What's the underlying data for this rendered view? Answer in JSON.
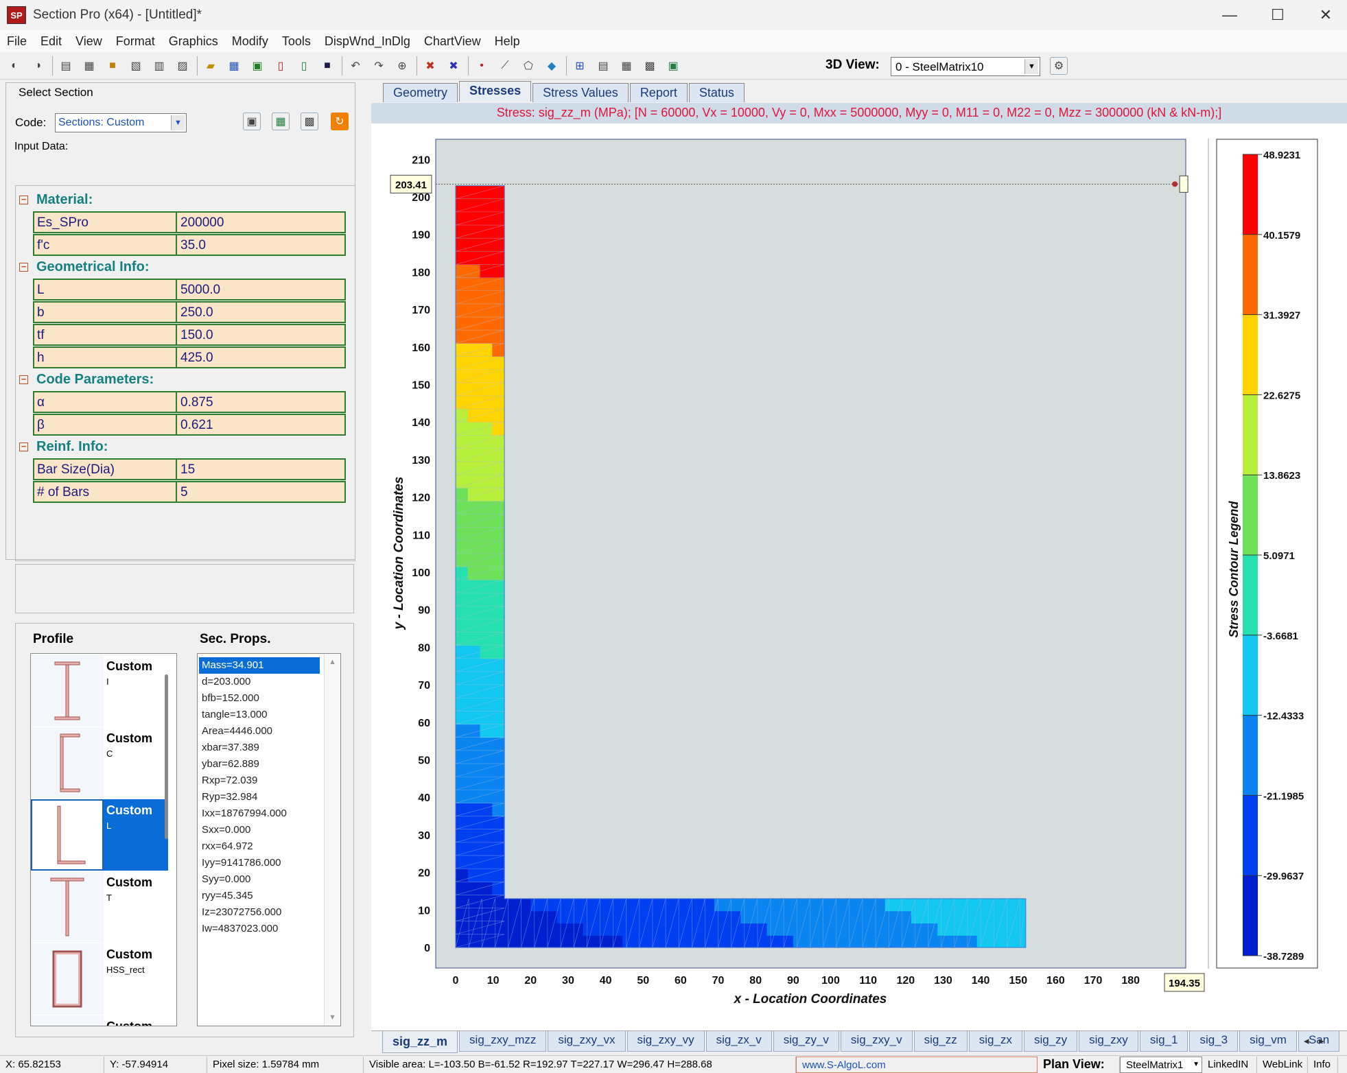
{
  "window": {
    "title": "Section Pro (x64) - [Untitled]*",
    "icon_text": "SP",
    "min_glyph": "—",
    "max_glyph": "☐",
    "close_glyph": "✕"
  },
  "menu": [
    "File",
    "Edit",
    "View",
    "Format",
    "Graphics",
    "Modify",
    "Tools",
    "DispWnd_InDlg",
    "ChartView",
    "Help"
  ],
  "toolbar": {
    "view3d_label": "3D View:",
    "view3d_value": "0 - SteelMatrix10"
  },
  "left": {
    "select_section_label": "Select Section",
    "code_label": "Code:",
    "code_value": "Sections: Custom",
    "input_data_label": "Input Data:",
    "sections": [
      {
        "title": "Material:",
        "rows": [
          {
            "k": "Es_SPro",
            "v": "200000"
          },
          {
            "k": "f'c",
            "v": "35.0"
          }
        ]
      },
      {
        "title": "Geometrical Info:",
        "rows": [
          {
            "k": "L",
            "v": "5000.0"
          },
          {
            "k": "b",
            "v": "250.0"
          },
          {
            "k": "tf",
            "v": "150.0"
          },
          {
            "k": "h",
            "v": "425.0"
          }
        ]
      },
      {
        "title": "Code Parameters:",
        "rows": [
          {
            "k": "α",
            "v": "0.875"
          },
          {
            "k": "β",
            "v": "0.621"
          }
        ]
      },
      {
        "title": "Reinf. Info:",
        "rows": [
          {
            "k": "Bar Size(Dia)",
            "v": "15"
          },
          {
            "k": "# of Bars",
            "v": "5"
          }
        ]
      }
    ],
    "profile_label": "Profile",
    "secprops_label": "Sec. Props.",
    "profiles": [
      {
        "name": "Custom",
        "sub": "I",
        "shape": "I"
      },
      {
        "name": "Custom",
        "sub": "C",
        "shape": "C"
      },
      {
        "name": "Custom",
        "sub": "L",
        "shape": "L",
        "selected": true
      },
      {
        "name": "Custom",
        "sub": "T",
        "shape": "T"
      },
      {
        "name": "Custom",
        "sub": "HSS_rect",
        "shape": "HSS"
      },
      {
        "name": "Custom",
        "sub": "",
        "shape": "pipe"
      }
    ],
    "secprops": [
      "Mass=34.901",
      "d=203.000",
      "bfb=152.000",
      "tangle=13.000",
      "Area=4446.000",
      "xbar=37.389",
      "ybar=62.889",
      "Rxp=72.039",
      "Ryp=32.984",
      "Ixx=18767994.000",
      "Sxx=0.000",
      "rxx=64.972",
      "Iyy=9141786.000",
      "Syy=0.000",
      "ryy=45.345",
      "Iz=23072756.000",
      "Iw=4837023.000"
    ]
  },
  "tabs": [
    "Geometry",
    "Stresses",
    "Stress Values",
    "Report",
    "Status"
  ],
  "active_tab": "Stresses",
  "stress_header": "Stress: sig_zz_m (MPa); [N = 60000, Vx = 10000, Vy = 0, Mxx = 5000000, Myy = 0, M11 = 0, M22 = 0, Mzz = 3000000 (kN & kN-m);]",
  "chart_data": {
    "type": "heatmap",
    "xlabel": "x - Location Coordinates",
    "ylabel": "y - Location Coordinates",
    "xlim": [
      0,
      200
    ],
    "ylim": [
      0,
      210
    ],
    "xticks": [
      "0",
      "10",
      "20",
      "30",
      "40",
      "50",
      "60",
      "70",
      "80",
      "90",
      "100",
      "110",
      "120",
      "130",
      "140",
      "150",
      "160",
      "170",
      "180"
    ],
    "yticks": [
      "0",
      "10",
      "20",
      "30",
      "40",
      "50",
      "60",
      "70",
      "80",
      "90",
      "100",
      "110",
      "120",
      "130",
      "140",
      "150",
      "160",
      "170",
      "180",
      "190",
      "200",
      "210"
    ],
    "cursor_y": "203.41",
    "cursor_x": "194.35",
    "section_L": {
      "vertical_leg": {
        "x": [
          0,
          13
        ],
        "y": [
          0,
          203
        ]
      },
      "horizontal_leg": {
        "x": [
          0,
          152
        ],
        "y": [
          0,
          13
        ]
      }
    },
    "legend_title": "Stress Contour Legend",
    "legend_values": [
      "48.9231",
      "40.1579",
      "31.3927",
      "22.6275",
      "13.8623",
      "5.0971",
      "-3.6681",
      "-12.4333",
      "-21.1985",
      "-29.9637",
      "-38.7289"
    ],
    "legend_colors": [
      "#ff0000",
      "#ff6a00",
      "#ffd400",
      "#b8ef3a",
      "#6ee05a",
      "#26e0b0",
      "#12c8f0",
      "#0a84f0",
      "#0040f0",
      "#0020d0",
      "#00109a"
    ]
  },
  "bottom_tabs": [
    "sig_zz_m",
    "sig_zxy_mzz",
    "sig_zxy_vx",
    "sig_zxy_vy",
    "sig_zx_v",
    "sig_zy_v",
    "sig_zxy_v",
    "sig_zz",
    "sig_zx",
    "sig_zy",
    "sig_zxy",
    "sig_1",
    "sig_3",
    "sig_vm",
    "San"
  ],
  "status": {
    "x": "X: 65.82153",
    "y": "Y: -57.94914",
    "pixel": "Pixel size: 1.59784 mm",
    "visible": "Visible area:  L=-103.50  B=-61.52  R=192.97  T=227.17   W=296.47  H=288.68",
    "url": "www.S-AlgoL.com",
    "plan_label": "Plan View:",
    "plan_value": "SteelMatrix1",
    "linkedin": "LinkedIN",
    "weblink": "WebLink",
    "info": "Info"
  }
}
